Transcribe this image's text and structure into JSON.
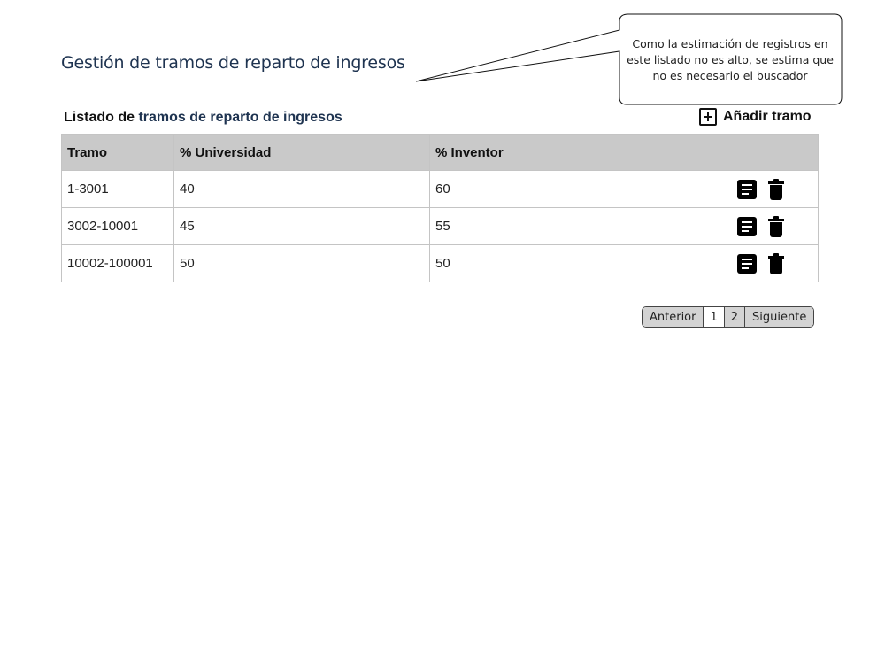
{
  "page": {
    "title": "Gestión de tramos de reparto de ingresos"
  },
  "callout": {
    "text": "Como la estimación de registros en este listado no es alto, se estima que no es necesario el buscador"
  },
  "list": {
    "title_prefix": "Listado de ",
    "title_accent": "tramos de reparto de ingresos",
    "add_label": "Añadir tramo",
    "add_icon": "plus-square-icon"
  },
  "table": {
    "headers": {
      "tramo": "Tramo",
      "universidad": "% Universidad",
      "inventor": "% Inventor",
      "actions": ""
    },
    "rows": [
      {
        "tramo": "1-3001",
        "universidad": "40",
        "inventor": "60"
      },
      {
        "tramo": "3002-10001",
        "universidad": "45",
        "inventor": "55"
      },
      {
        "tramo": "10002-100001",
        "universidad": "50",
        "inventor": "50"
      }
    ],
    "row_icons": [
      "document-icon",
      "trash-icon"
    ]
  },
  "pagination": {
    "previous": "Anterior",
    "pages": [
      "1",
      "2"
    ],
    "current_page": "2",
    "next": "Siguiente"
  },
  "colors": {
    "title": "#1e3350",
    "header_bg": "#c9c9c9",
    "border": "#c4c4c4"
  }
}
